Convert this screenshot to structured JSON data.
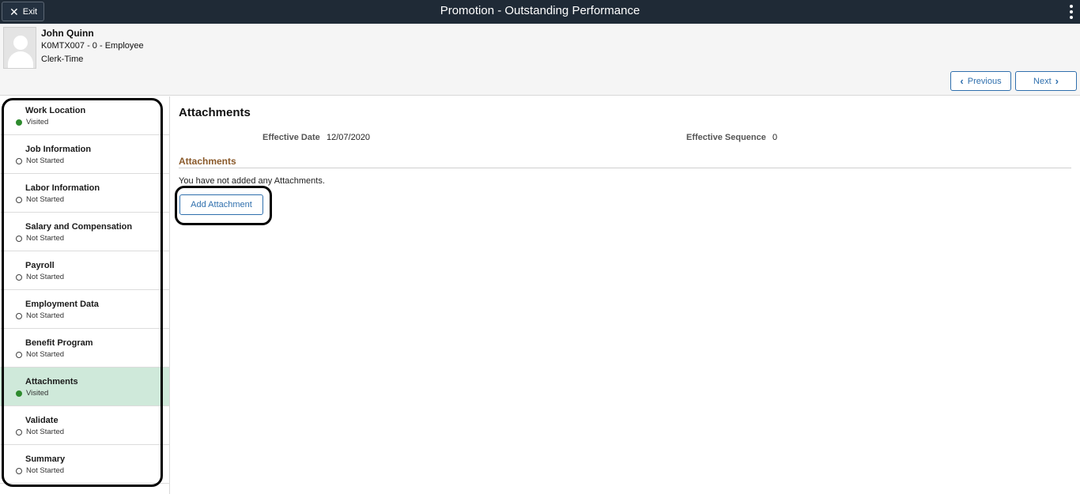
{
  "topbar": {
    "exit_label": "Exit",
    "title": "Promotion - Outstanding Performance"
  },
  "employee": {
    "name": "John Quinn",
    "id_line": "K0MTX007 - 0 - Employee",
    "job": "Clerk-Time"
  },
  "nav": {
    "previous_label": "Previous",
    "next_label": "Next"
  },
  "sidebar": {
    "items": [
      {
        "label": "Work Location",
        "status": "Visited",
        "visited": true
      },
      {
        "label": "Job Information",
        "status": "Not Started",
        "visited": false
      },
      {
        "label": "Labor Information",
        "status": "Not Started",
        "visited": false
      },
      {
        "label": "Salary and Compensation",
        "status": "Not Started",
        "visited": false
      },
      {
        "label": "Payroll",
        "status": "Not Started",
        "visited": false
      },
      {
        "label": "Employment Data",
        "status": "Not Started",
        "visited": false
      },
      {
        "label": "Benefit Program",
        "status": "Not Started",
        "visited": false
      },
      {
        "label": "Attachments",
        "status": "Visited",
        "visited": true,
        "active": true
      },
      {
        "label": "Validate",
        "status": "Not Started",
        "visited": false
      },
      {
        "label": "Summary",
        "status": "Not Started",
        "visited": false
      }
    ]
  },
  "main": {
    "title": "Attachments",
    "effective_date_label": "Effective Date",
    "effective_date": "12/07/2020",
    "effective_sequence_label": "Effective Sequence",
    "effective_sequence": "0",
    "section_title": "Attachments",
    "empty_message": "You have not added any Attachments.",
    "add_button_label": "Add Attachment"
  },
  "colors": {
    "topbar_bg": "#1f2a36",
    "active_step_bg": "#cfe9da",
    "visited_dot": "#2e8b2e",
    "link_blue": "#2f6fad",
    "section_title": "#8a5a2b"
  }
}
